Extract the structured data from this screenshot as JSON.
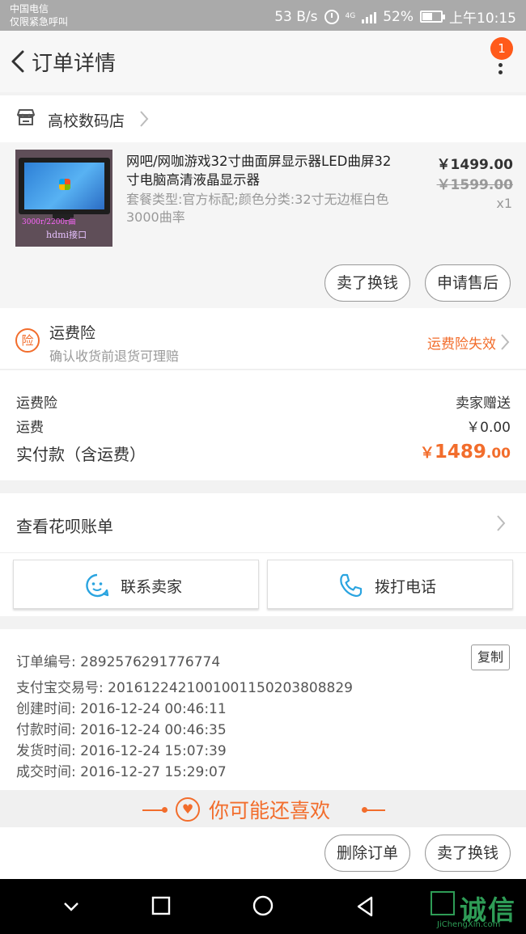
{
  "status_bar": {
    "carrier": "中国电信",
    "carrier_note": "仅限紧急呼叫",
    "network_speed": "53 B/s",
    "network_type": "4G",
    "battery": "52%",
    "time": "上午10:15"
  },
  "header": {
    "title": "订单详情",
    "notification_count": "1",
    "icons": {
      "back": "chevron-left-icon",
      "more": "more-vertical-icon"
    }
  },
  "shop": {
    "name": "高校数码店",
    "icon": "store-icon"
  },
  "product": {
    "title": "网吧/网咖游戏32寸曲面屏显示器LED曲屏32寸电脑高清液晶显示器",
    "spec": "套餐类型:官方标配;颜色分类:32寸无边框白色3000曲率",
    "price": "￥1499.00",
    "original_price": "￥1599.00",
    "quantity": "x1",
    "image_caption_1": "3000r/2200r曲",
    "image_caption_2": "hdmi接口",
    "actions": [
      "卖了换钱",
      "申请售后"
    ]
  },
  "insurance": {
    "icon_label": "险",
    "title": "运费险",
    "subtitle": "确认收货前退货可理赔",
    "status": "运费险失效",
    "accent": "#f26d2c"
  },
  "costs": {
    "rows": [
      {
        "label": "运费险",
        "value": "卖家赠送"
      },
      {
        "label": "运费",
        "value": "￥0.00"
      }
    ],
    "total_label": "实付款（含运费）",
    "total_symbol": "￥",
    "total_integer": "1489",
    "total_decimal": ".00"
  },
  "huabei": {
    "label": "查看花呗账单"
  },
  "contact": {
    "seller_label": "联系卖家",
    "phone_label": "拨打电话",
    "icons": {
      "seller": "chat-face-icon",
      "phone": "phone-icon"
    }
  },
  "order_info": {
    "copy_label": "复制",
    "lines": [
      "订单编号: 2892576291776774",
      "支付宝交易号: 2016122421001001150203808829",
      "创建时间: 2016-12-24 00:46:11",
      "付款时间: 2016-12-24 00:46:35",
      "发货时间: 2016-12-24 15:07:39",
      "成交时间: 2016-12-27 15:29:07"
    ]
  },
  "recommend": {
    "title": "你可能还喜欢",
    "icon": "heart-icon"
  },
  "bottom_actions": [
    "删除订单",
    "卖了换钱"
  ],
  "system_nav": {
    "icons": [
      "nav-down-icon",
      "nav-recent-icon",
      "nav-home-icon",
      "nav-back-icon"
    ],
    "watermark": "诚信",
    "watermark_sub": "JiChengXin.com"
  }
}
